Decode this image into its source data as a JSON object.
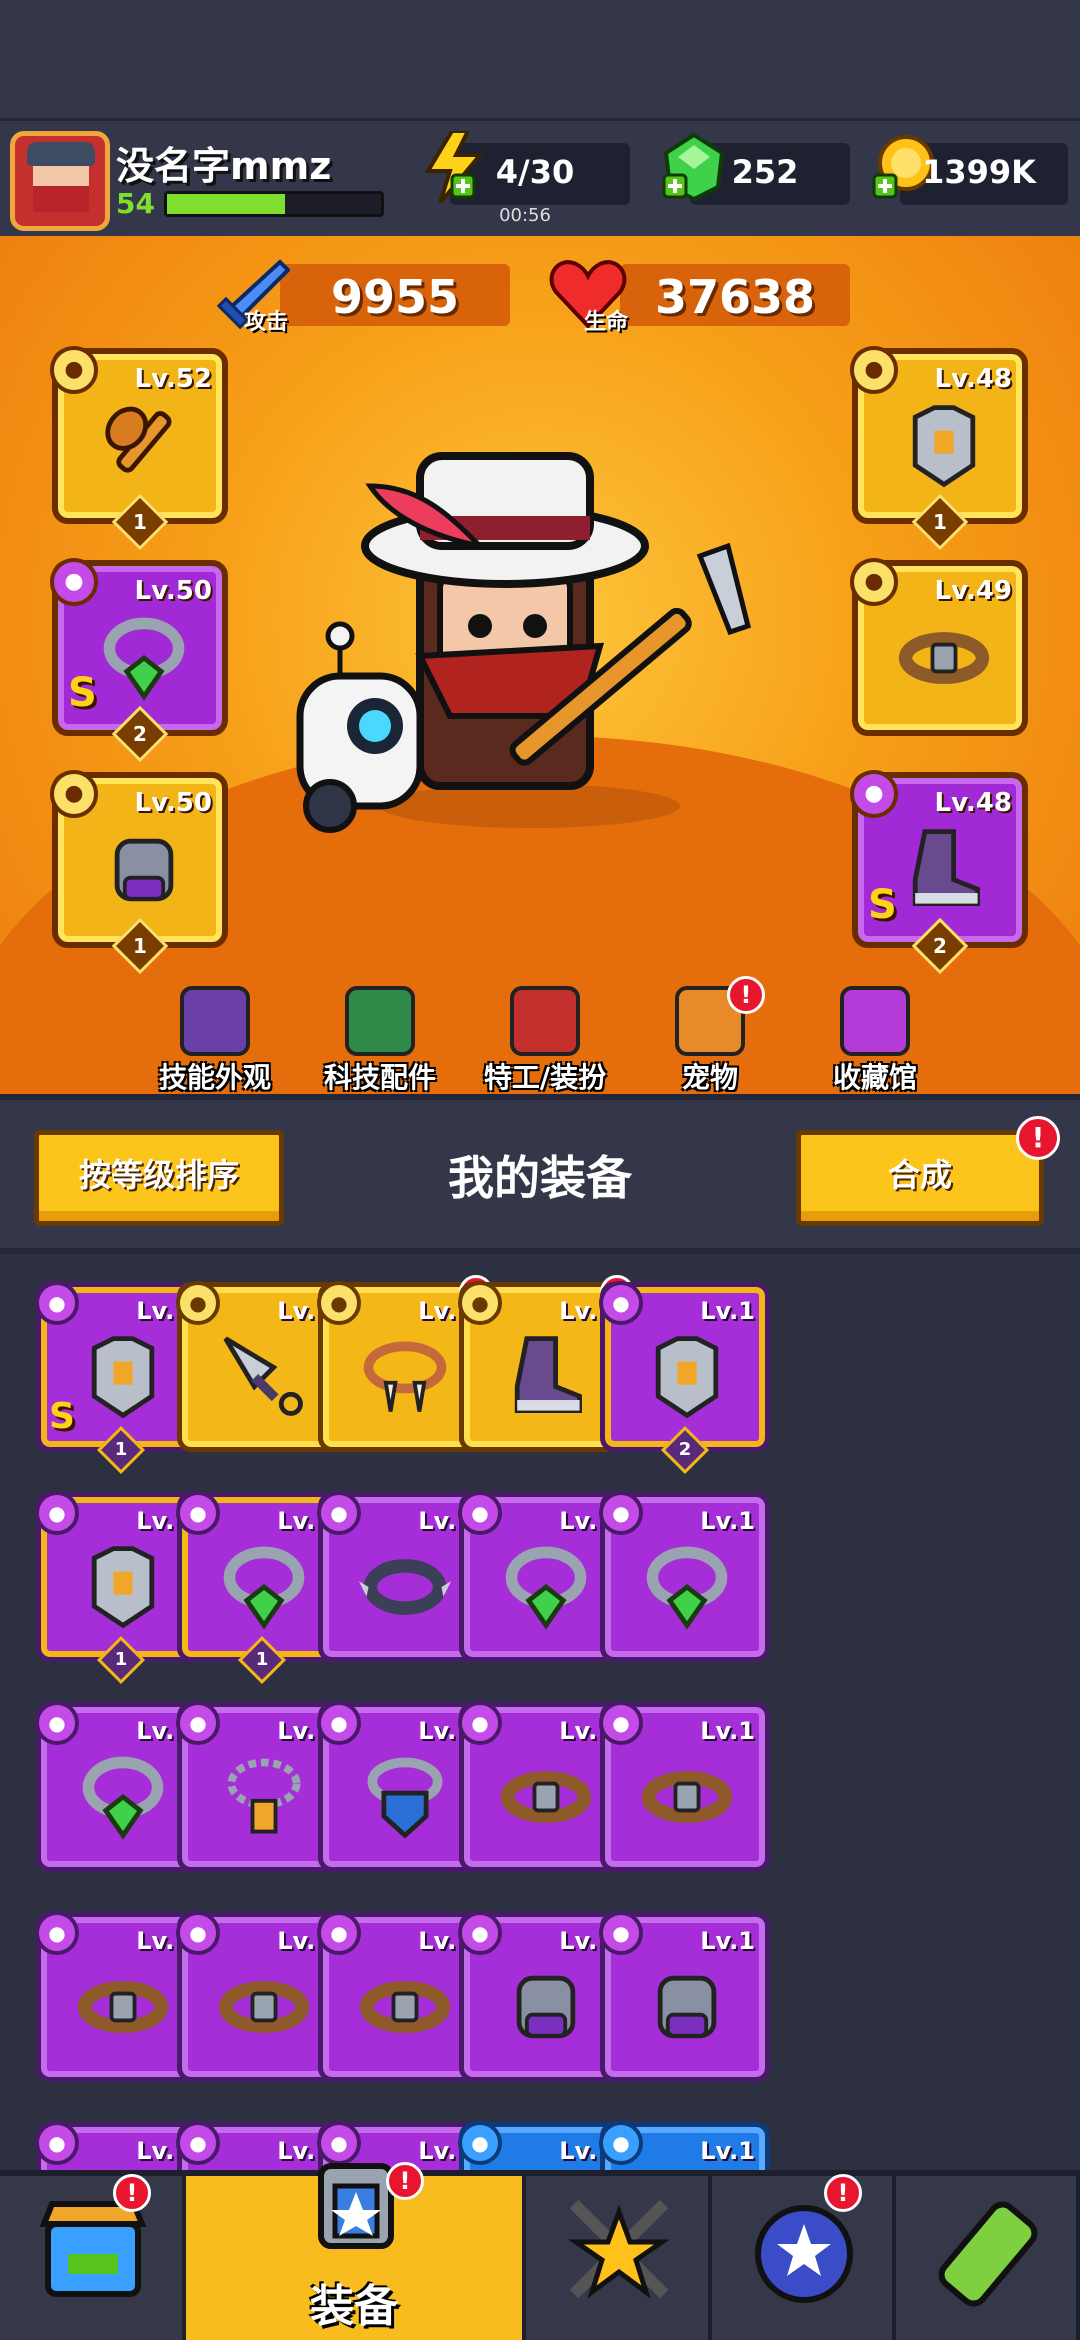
{
  "player": {
    "name": "没名字mmz",
    "level": "54",
    "xp_fraction": 0.55
  },
  "resources": {
    "energy": {
      "value": "4/30",
      "timer": "00:56",
      "icon": "lightning-icon"
    },
    "gems": {
      "value": "252",
      "icon": "gem-icon"
    },
    "coins": {
      "value": "1399K",
      "icon": "coin-icon"
    }
  },
  "stats": {
    "attack": {
      "label": "攻击",
      "value": "9955"
    },
    "hp": {
      "label": "生命",
      "value": "37638"
    }
  },
  "equipped": {
    "left": [
      {
        "type": "weapon",
        "level": "Lv.52",
        "count": "1",
        "rank": "",
        "color": "gold"
      },
      {
        "type": "necklace",
        "level": "Lv.50",
        "count": "2",
        "rank": "S",
        "color": "purple"
      },
      {
        "type": "glove",
        "level": "Lv.50",
        "count": "1",
        "rank": "",
        "color": "gold"
      }
    ],
    "right": [
      {
        "type": "armor",
        "level": "Lv.48",
        "count": "1",
        "rank": "",
        "color": "gold"
      },
      {
        "type": "belt",
        "level": "Lv.49",
        "count": "",
        "rank": "",
        "color": "gold"
      },
      {
        "type": "boots",
        "level": "Lv.48",
        "count": "2",
        "rank": "S",
        "color": "purple"
      }
    ]
  },
  "menu": [
    {
      "label": "技能外观",
      "icon": "skill-skin-icon",
      "alert": false
    },
    {
      "label": "科技配件",
      "icon": "tech-parts-icon",
      "alert": false
    },
    {
      "label": "特工/装扮",
      "icon": "agent-costume-icon",
      "alert": false
    },
    {
      "label": "宠物",
      "icon": "pet-icon",
      "alert": true
    },
    {
      "label": "收藏馆",
      "icon": "collection-icon",
      "alert": false
    }
  ],
  "equipment_bar": {
    "sort_label": "按等级排序",
    "title": "我的装备",
    "merge_label": "合成",
    "alert_mark": "!"
  },
  "inventory": [
    {
      "lv": "Lv.1",
      "color": "purplegold",
      "count": "1",
      "rank": "S",
      "alert": false,
      "icon": "armor-icon"
    },
    {
      "lv": "Lv.1",
      "color": "gold",
      "count": "",
      "rank": "",
      "alert": false,
      "icon": "kunai-icon"
    },
    {
      "lv": "Lv.1",
      "color": "gold",
      "count": "",
      "rank": "",
      "alert": true,
      "icon": "fang-necklace-icon"
    },
    {
      "lv": "Lv.1",
      "color": "gold",
      "count": "",
      "rank": "",
      "alert": true,
      "icon": "boots-icon"
    },
    {
      "lv": "Lv.1",
      "color": "purplegold",
      "count": "2",
      "rank": "",
      "alert": false,
      "icon": "armor-icon"
    },
    {
      "lv": "Lv.1",
      "color": "purplegold",
      "count": "1",
      "rank": "",
      "alert": false,
      "icon": "armor-icon"
    },
    {
      "lv": "Lv.1",
      "color": "purplegold",
      "count": "1",
      "rank": "",
      "alert": false,
      "icon": "necklace-icon"
    },
    {
      "lv": "Lv.1",
      "color": "purple",
      "count": "",
      "rank": "",
      "alert": false,
      "icon": "spike-collar-icon"
    },
    {
      "lv": "Lv.1",
      "color": "purple",
      "count": "",
      "rank": "",
      "alert": false,
      "icon": "necklace-icon"
    },
    {
      "lv": "Lv.1",
      "color": "purple",
      "count": "",
      "rank": "",
      "alert": false,
      "icon": "necklace-icon"
    },
    {
      "lv": "Lv.1",
      "color": "purple",
      "count": "",
      "rank": "",
      "alert": false,
      "icon": "necklace-icon"
    },
    {
      "lv": "Lv.1",
      "color": "purple",
      "count": "",
      "rank": "",
      "alert": false,
      "icon": "chain-necklace-icon"
    },
    {
      "lv": "Lv.1",
      "color": "purple",
      "count": "",
      "rank": "",
      "alert": false,
      "icon": "shield-necklace-icon"
    },
    {
      "lv": "Lv.1",
      "color": "purple",
      "count": "",
      "rank": "",
      "alert": false,
      "icon": "belt-icon"
    },
    {
      "lv": "Lv.1",
      "color": "purple",
      "count": "",
      "rank": "",
      "alert": false,
      "icon": "belt-icon"
    },
    {
      "lv": "Lv.1",
      "color": "purple",
      "count": "",
      "rank": "",
      "alert": false,
      "icon": "belt-icon"
    },
    {
      "lv": "Lv.1",
      "color": "purple",
      "count": "",
      "rank": "",
      "alert": false,
      "icon": "belt-icon"
    },
    {
      "lv": "Lv.1",
      "color": "purple",
      "count": "",
      "rank": "",
      "alert": false,
      "icon": "belt-icon"
    },
    {
      "lv": "Lv.1",
      "color": "purple",
      "count": "",
      "rank": "",
      "alert": false,
      "icon": "glove-icon"
    },
    {
      "lv": "Lv.1",
      "color": "purple",
      "count": "",
      "rank": "",
      "alert": false,
      "icon": "glove-icon"
    },
    {
      "lv": "Lv.1",
      "color": "purple",
      "count": "",
      "rank": "",
      "alert": false,
      "icon": "boots-icon"
    },
    {
      "lv": "Lv.1",
      "color": "purple",
      "count": "",
      "rank": "",
      "alert": false,
      "icon": "boots-icon"
    },
    {
      "lv": "Lv.1",
      "color": "purple",
      "count": "",
      "rank": "",
      "alert": false,
      "icon": "boots-icon"
    },
    {
      "lv": "Lv.1",
      "color": "blue",
      "count": "",
      "rank": "",
      "alert": false,
      "icon": "weapon-icon"
    },
    {
      "lv": "Lv.1",
      "color": "blue",
      "count": "",
      "rank": "",
      "alert": false,
      "icon": "weapon-icon"
    }
  ],
  "nav": [
    {
      "label": "",
      "icon": "shop-icon",
      "alert": true
    },
    {
      "label": "装备",
      "icon": "equipment-icon",
      "alert": true
    },
    {
      "label": "",
      "icon": "battle-icon",
      "alert": false
    },
    {
      "label": "",
      "icon": "talent-icon",
      "alert": true
    },
    {
      "label": "",
      "icon": "evolution-icon",
      "alert": false
    }
  ],
  "colors": {
    "accent": "#fbc51c",
    "purple": "#a52ed9",
    "gold": "#f4b718",
    "alert": "#e8152f"
  }
}
